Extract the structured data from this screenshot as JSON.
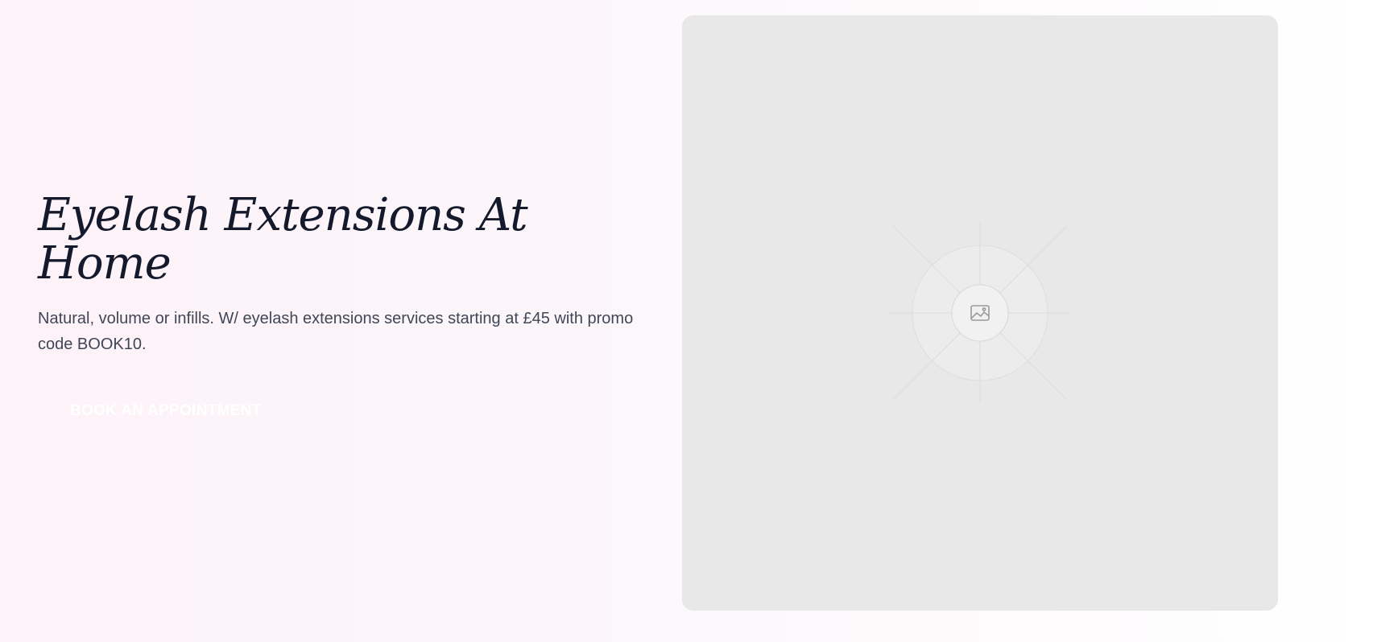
{
  "hero": {
    "title": "Eyelash Extensions At Home",
    "subtitle": "Natural, volume or infills. W/ eyelash extensions services starting at £45 with promo code BOOK10.",
    "cta_label": "BOOK AN APPOINTMENT"
  },
  "image": {
    "icon": "image-icon"
  },
  "colors": {
    "title": "#141a2c",
    "subtitle": "#3f4757",
    "placeholder_bg": "#e8e8e8",
    "background_start": "#fdf2f8"
  }
}
